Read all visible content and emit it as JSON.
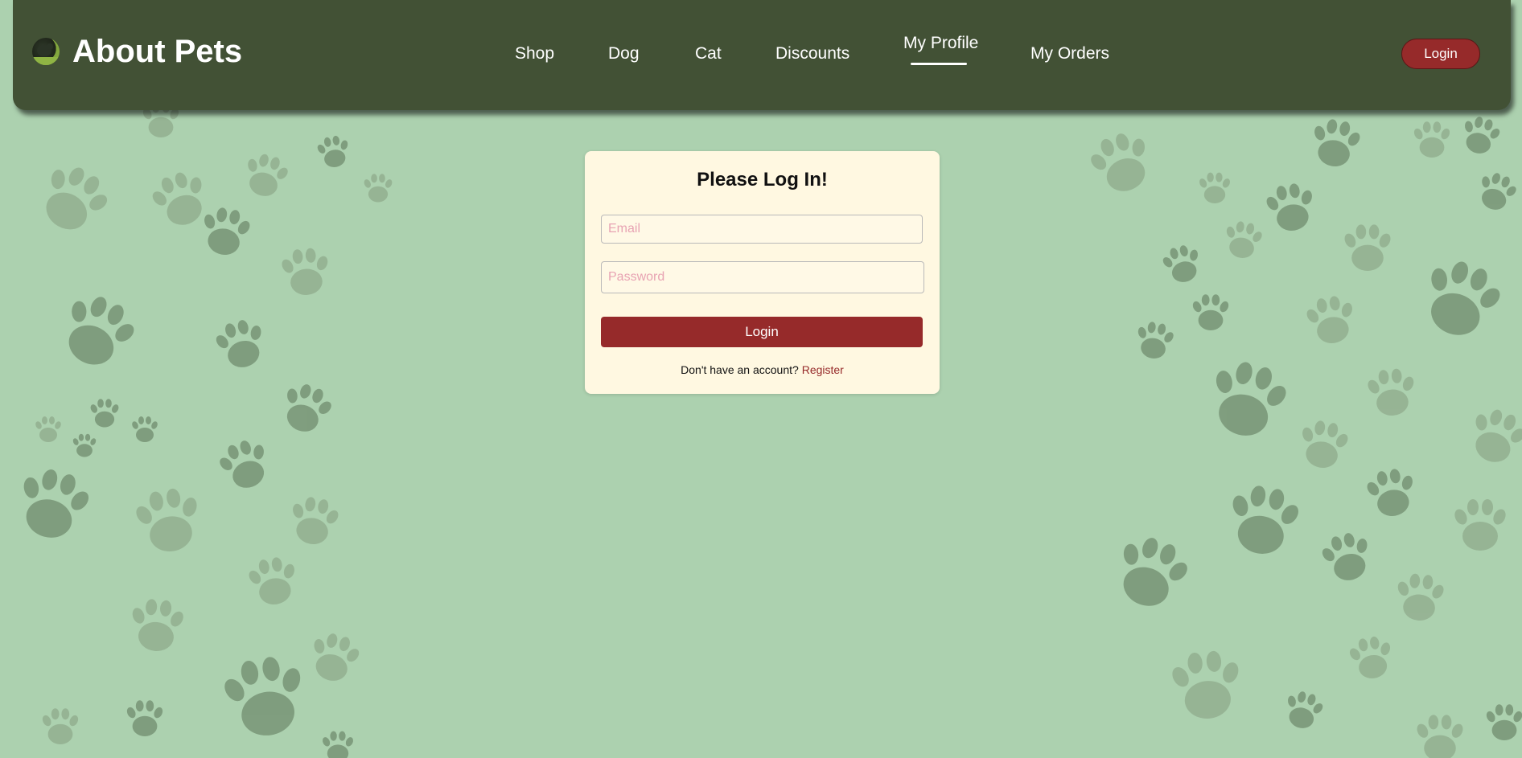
{
  "header": {
    "brand_title": "About Pets",
    "logo_icon": "pet-logo-icon",
    "nav": [
      {
        "label": "Shop",
        "active": false
      },
      {
        "label": "Dog",
        "active": false
      },
      {
        "label": "Cat",
        "active": false
      },
      {
        "label": "Discounts",
        "active": false
      },
      {
        "label": "My Profile",
        "active": true
      },
      {
        "label": "My Orders",
        "active": false
      }
    ],
    "login_label": "Login"
  },
  "login_form": {
    "title": "Please Log In!",
    "email_placeholder": "Email",
    "password_placeholder": "Password",
    "submit_label": "Login",
    "register_prompt": "Don't have an account?",
    "register_link": "Register"
  },
  "colors": {
    "background": "#acd1af",
    "navbar": "#425135",
    "accent": "#962a2a",
    "card": "#fff8e1",
    "placeholder": "#e8a3b3"
  },
  "background_pattern": "paw-print-icon"
}
